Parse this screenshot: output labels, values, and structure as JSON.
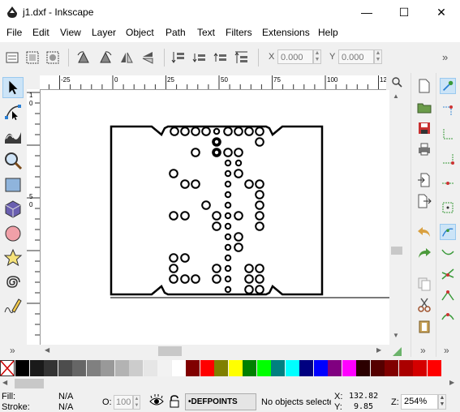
{
  "window": {
    "title": "j1.dxf - Inkscape",
    "minimize_glyph": "—",
    "maximize_glyph": "☐",
    "close_glyph": "✕"
  },
  "menu": [
    "File",
    "Edit",
    "View",
    "Layer",
    "Object",
    "Path",
    "Text",
    "Filters",
    "Extensions",
    "Help"
  ],
  "toolbar": {
    "x_label": "X",
    "x_value": "0.000",
    "y_label": "Y",
    "y_value": "0.000",
    "overflow": "»"
  },
  "tools": [
    "selector-tool-icon",
    "node-tool-icon",
    "tweak-tool-icon",
    "zoom-tool-icon",
    "rectangle-tool-icon",
    "box3d-tool-icon",
    "ellipse-tool-icon",
    "star-tool-icon",
    "spiral-tool-icon",
    "pencil-tool-icon"
  ],
  "toolbox_overflow": "»",
  "ruler": {
    "h_labels": [
      "-25",
      "0",
      "25",
      "50",
      "75",
      "100",
      "125"
    ],
    "v_labels": [
      "1",
      "0",
      "5",
      "0"
    ]
  },
  "palette_colors": [
    "#000000",
    "#1a1a1a",
    "#333333",
    "#4d4d4d",
    "#666666",
    "#808080",
    "#999999",
    "#b3b3b3",
    "#cccccc",
    "#e6e6e6",
    "#f2f2f2",
    "#ffffff",
    "#800000",
    "#ff0000",
    "#808000",
    "#ffff00",
    "#008000",
    "#00ff00",
    "#008080",
    "#00ffff",
    "#000080",
    "#0000ff",
    "#800080",
    "#ff00ff",
    "#2b0000",
    "#550000",
    "#800000",
    "#aa0000",
    "#d40000",
    "#ff0000"
  ],
  "status": {
    "fill_label": "Fill:",
    "fill_value": "N/A",
    "stroke_label": "Stroke:",
    "stroke_value": "N/A",
    "opacity_label": "O:",
    "opacity_value": "100",
    "layer": "•DEFPOINTS",
    "message": "No objects selected.",
    "x_label": "X:",
    "x_value": "132.82",
    "y_label": "Y:",
    "y_value": "9.85",
    "zoom_label": "Z:",
    "zoom_value": "254%"
  },
  "colors": {
    "accent": "#0078d7",
    "tool_active_bg": "#cce4f7"
  }
}
